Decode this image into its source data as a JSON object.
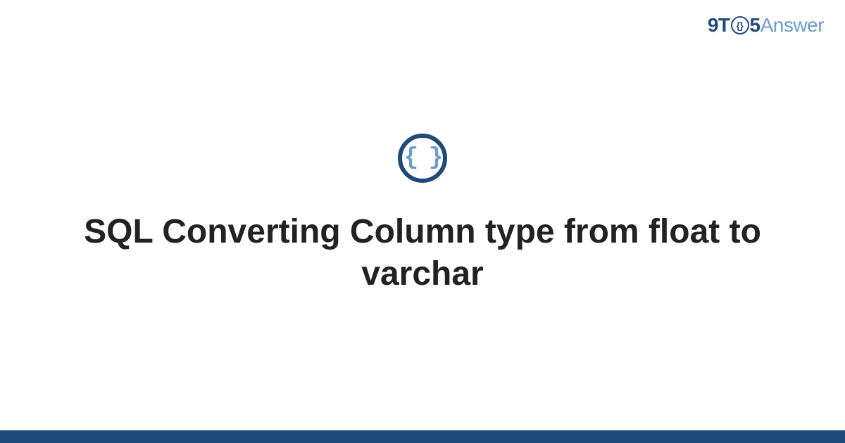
{
  "brand": {
    "prefix": "9T",
    "circle_glyph": "{}",
    "mid": "5",
    "suffix": "Answer"
  },
  "icon": {
    "glyph": "{ }"
  },
  "title": "SQL Converting Column type from float to varchar",
  "colors": {
    "primary": "#1e4a7a",
    "accent": "#6b9bd1"
  }
}
